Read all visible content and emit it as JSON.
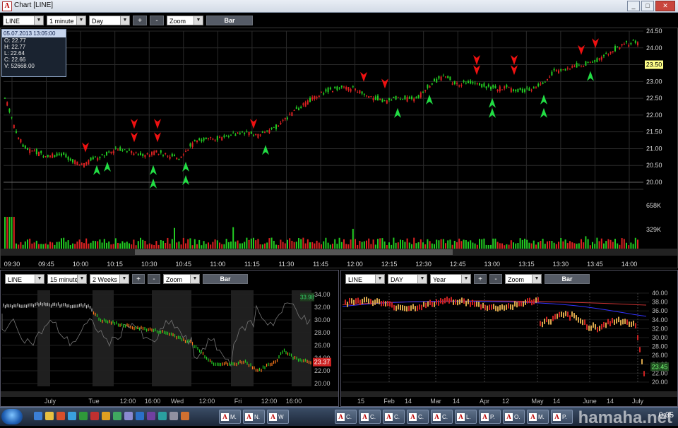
{
  "window": {
    "title": "Chart [LINE]",
    "app_letter": "A",
    "minimize": "_",
    "restore": "□",
    "close": "✕"
  },
  "main_toolbar": {
    "symbol": "LINE",
    "interval": "1 minute",
    "range": "Day",
    "zoom_in": "+",
    "zoom_out": "-",
    "zoom": "Zoom",
    "chart_type": "Bar"
  },
  "info_box": {
    "header": "05.07.2013 13:05:00",
    "open": "O: 22.77",
    "high": "H: 22.77",
    "low": "L: 22.64",
    "close": "C: 22.66",
    "volume": "V: 52668.00"
  },
  "main_chart": {
    "price_ticks": [
      "24.50",
      "24.00",
      "23.50",
      "23.00",
      "22.50",
      "22.00",
      "21.50",
      "21.00",
      "20.50",
      "20.00"
    ],
    "current_price": "23.50",
    "volume_ticks": [
      "658K",
      "329K"
    ],
    "time_ticks": [
      "09:30",
      "09:45",
      "10:00",
      "10:15",
      "10:30",
      "10:45",
      "11:00",
      "11:15",
      "11:30",
      "11:45",
      "12:00",
      "12:15",
      "12:30",
      "12:45",
      "13:00",
      "13:15",
      "13:30",
      "13:45",
      "14:00"
    ]
  },
  "bottom_left": {
    "toolbar": {
      "symbol": "LINE",
      "interval": "15 minutes",
      "range": "2 Weeks",
      "zoom_in": "+",
      "zoom_out": "-",
      "zoom": "Zoom",
      "chart_type": "Bar"
    },
    "price_ticks": [
      "34.00",
      "32.00",
      "30.00",
      "28.00",
      "26.00",
      "24.00",
      "22.00",
      "20.00"
    ],
    "top_label": "33.98",
    "current_price": "23.37",
    "time_ticks": [
      "July",
      "Tue",
      "12:00",
      "16:00",
      "Wed",
      "12:00",
      "Fri",
      "12:00",
      "16:00"
    ]
  },
  "bottom_right": {
    "toolbar": {
      "symbol": "LINE",
      "interval": "DAY",
      "range": "Year",
      "zoom_in": "+",
      "zoom_out": "-",
      "zoom": "Zoom",
      "chart_type": "Bar"
    },
    "price_ticks": [
      "40.00",
      "38.00",
      "36.00",
      "34.00",
      "32.00",
      "30.00",
      "28.00",
      "26.00",
      "24.00",
      "22.00",
      "20.00"
    ],
    "current_price": "23.45",
    "time_ticks": [
      "15",
      "Feb",
      "14",
      "Mar",
      "14",
      "Apr",
      "12",
      "May",
      "14",
      "June",
      "14",
      "July"
    ]
  },
  "taskbar": {
    "items": [
      "C.",
      "C.",
      "C.",
      "C.",
      "C.",
      "L.",
      "P.",
      "O.",
      "M.",
      "P."
    ],
    "left_items": [
      "M.",
      "N.",
      "W"
    ],
    "clock": "0:05"
  },
  "watermark": "hamaha.net",
  "colors": {
    "up": "#22cc22",
    "down": "#dd2222",
    "up_arrow": "#22dd44",
    "down_arrow": "#ee1111",
    "price_tag": "#ffff88",
    "accent_red": "#cc2222"
  }
}
